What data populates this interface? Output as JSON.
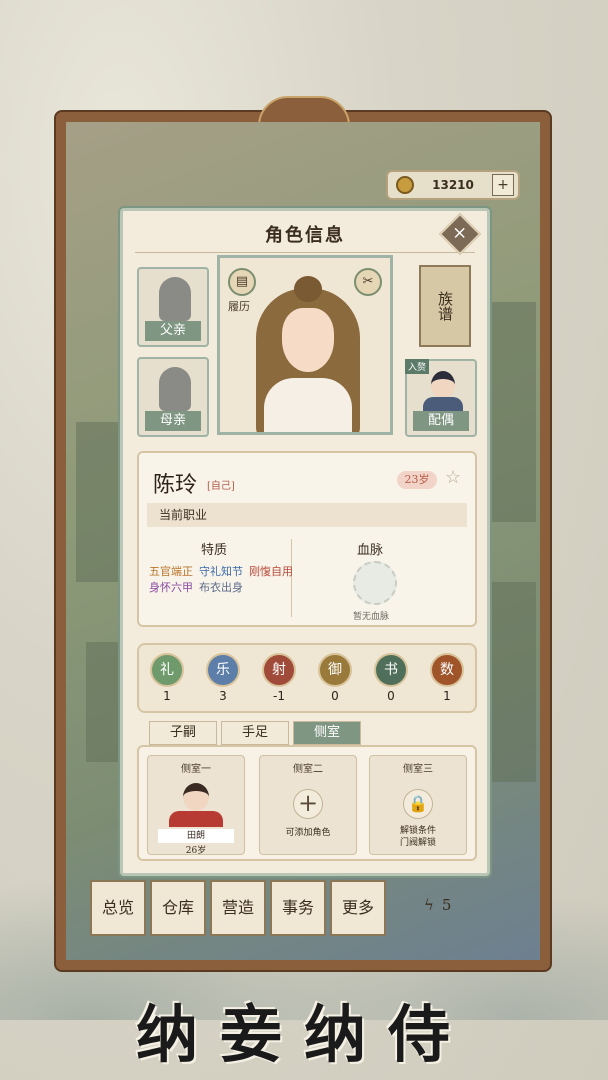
{
  "hud": {
    "coins": "13210",
    "plus": "+"
  },
  "panel": {
    "title": "角色信息",
    "close": "×",
    "father_label": "父亲",
    "mother_label": "母亲",
    "resume_label": "履历",
    "genealogy_label": "族谱",
    "spouse_label": "配偶",
    "spouse_tag": "入赘"
  },
  "character": {
    "name": "陈玲",
    "self_tag": "[自己]",
    "age": "23岁",
    "job_label": "当前职业",
    "traits_title": "特质",
    "bloodline_title": "血脉",
    "traits": [
      {
        "text": "五官端正",
        "color": "#b8742a"
      },
      {
        "text": "守礼知节",
        "color": "#3c6aa8"
      },
      {
        "text": "刚愎自用",
        "color": "#b84a3a"
      },
      {
        "text": "身怀六甲",
        "color": "#8a4aa0"
      },
      {
        "text": "布衣出身",
        "color": "#5c6c8a"
      }
    ],
    "bloodline_none": "暂无血脉"
  },
  "attributes": [
    {
      "name": "礼",
      "value": "1",
      "color": "#6e9a6c"
    },
    {
      "name": "乐",
      "value": "3",
      "color": "#5c7ea8"
    },
    {
      "name": "射",
      "value": "-1",
      "color": "#a04a3a"
    },
    {
      "name": "御",
      "value": "0",
      "color": "#9a7a3a"
    },
    {
      "name": "书",
      "value": "0",
      "color": "#4f6f5a"
    },
    {
      "name": "数",
      "value": "1",
      "color": "#a0542a"
    }
  ],
  "tabs": [
    "子嗣",
    "手足",
    "侧室"
  ],
  "concubines": [
    {
      "title": "侧室一",
      "name": "田朗",
      "age": "26岁"
    },
    {
      "title": "侧室二",
      "desc": "可添加角色"
    },
    {
      "title": "侧室三",
      "desc1": "解锁条件",
      "desc2": "门阀解锁"
    }
  ],
  "bottom_nav": [
    "总览",
    "仓库",
    "营造",
    "事务",
    "更多"
  ],
  "side_stat": {
    "value": "5"
  },
  "banner": "纳妾纳侍"
}
